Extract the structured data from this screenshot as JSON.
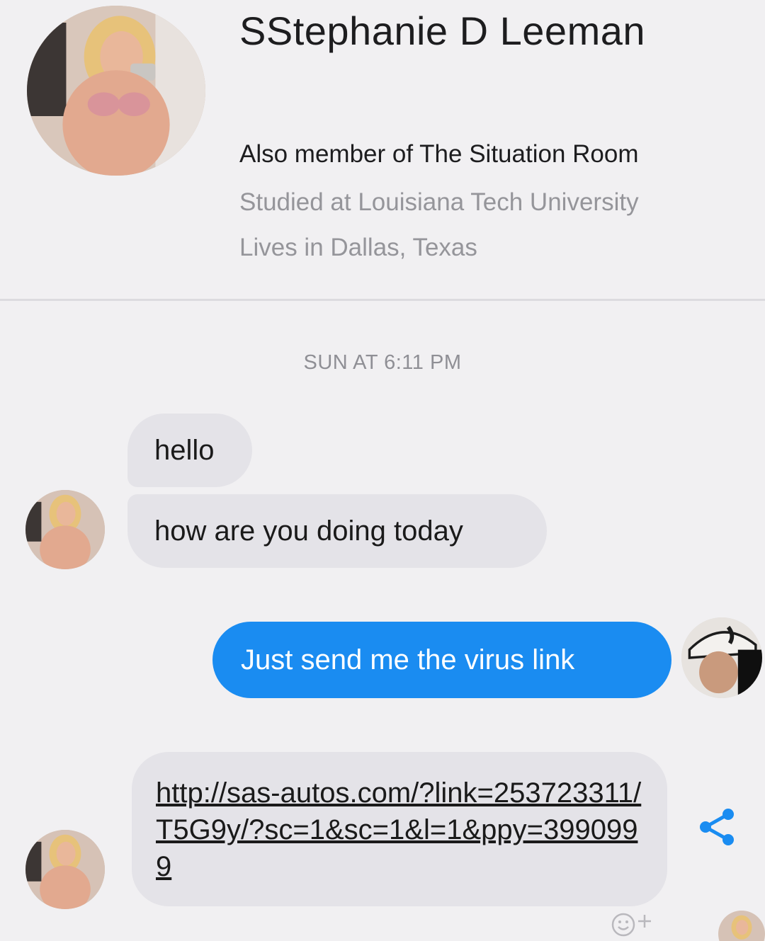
{
  "profile": {
    "name": "SStephanie D Leeman",
    "member_of": "Also member of The Situation Room",
    "studied": "Studied at Louisiana Tech University",
    "lives": "Lives in Dallas, Texas",
    "avatar_icon": "profile-photo"
  },
  "conversation": {
    "timestamp": "SUN AT 6:11 PM",
    "messages": [
      {
        "sender": "Stephanie",
        "direction": "incoming",
        "text": "hello"
      },
      {
        "sender": "Stephanie",
        "direction": "incoming",
        "text": "how are you doing today"
      },
      {
        "sender": "user",
        "direction": "outgoing",
        "text": "Just send me the virus link"
      },
      {
        "sender": "Stephanie",
        "direction": "incoming",
        "text": "http://sas-autos.com/?link=253723311/T5G9y/?sc=1&sc=1&l=1&ppy=3990999"
      }
    ]
  },
  "icons": {
    "share": "share-icon",
    "reaction": "add-reaction-icon"
  },
  "colors": {
    "background": "#f1f0f2",
    "incoming_bubble": "#e4e3e8",
    "outgoing_bubble": "#1a8cf1",
    "secondary_text": "#95959a"
  }
}
